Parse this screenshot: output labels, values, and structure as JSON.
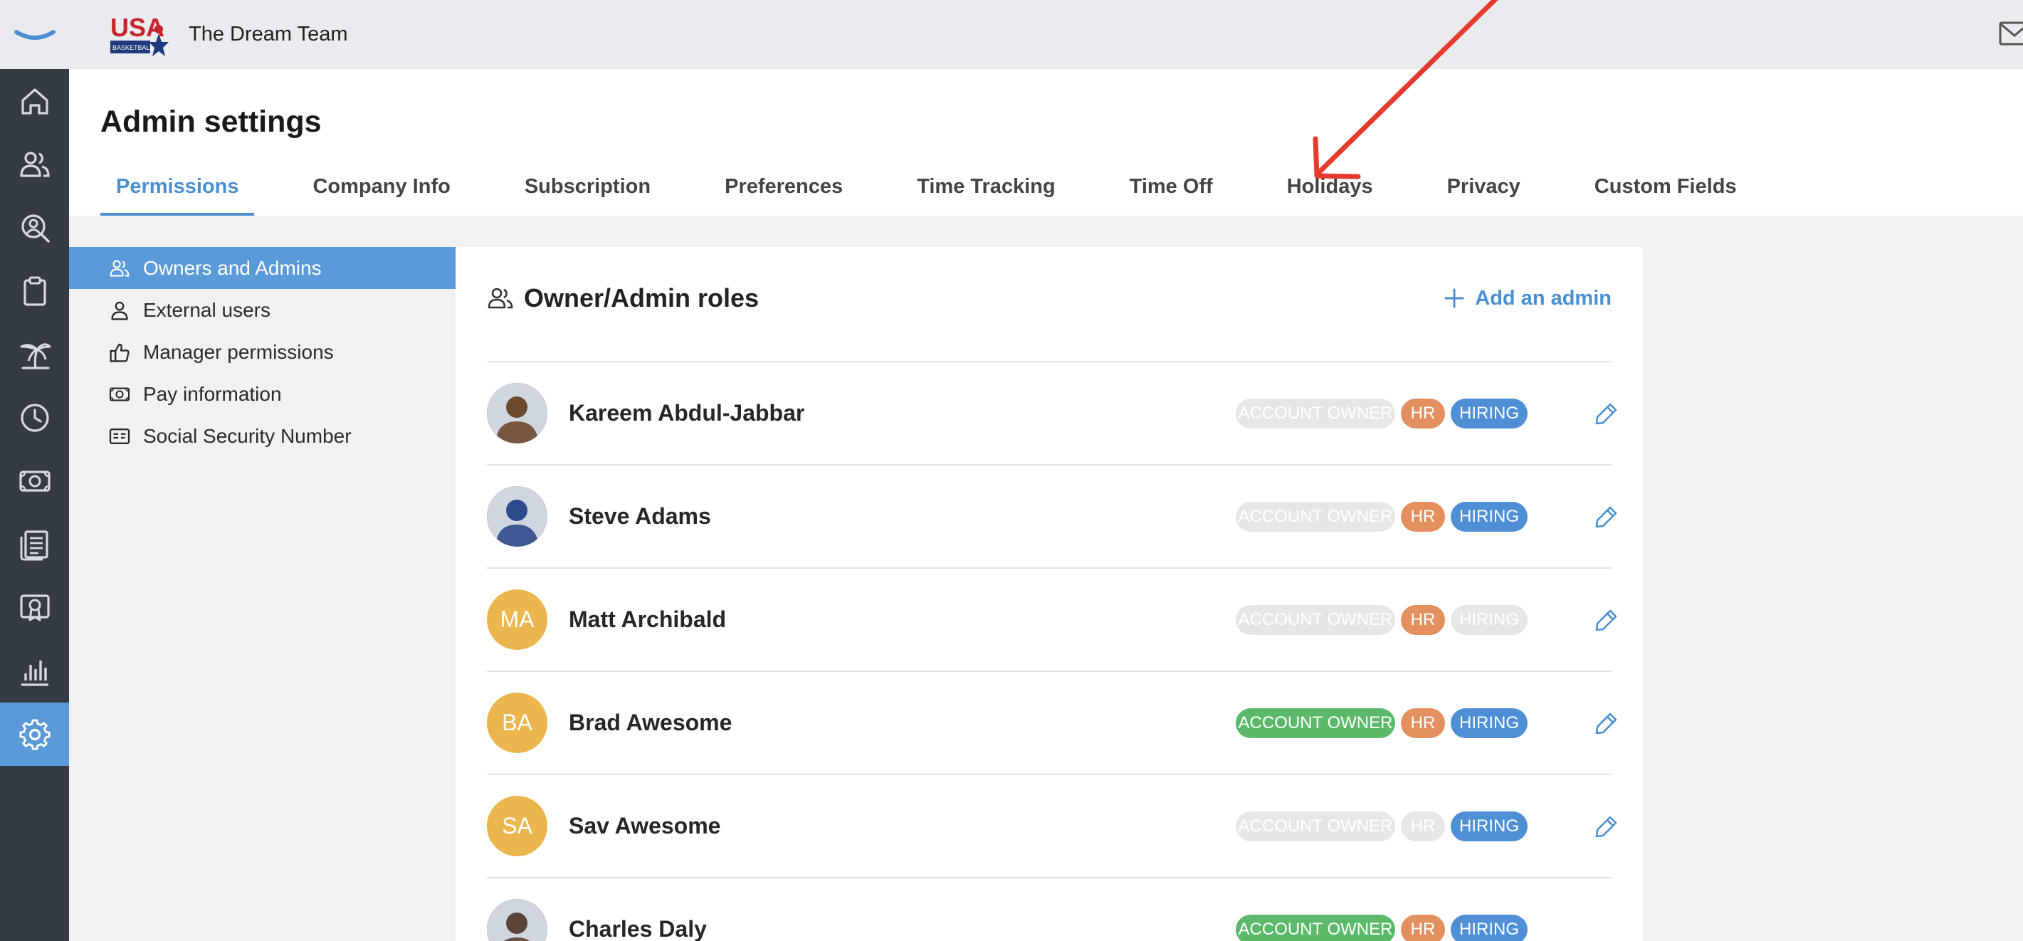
{
  "colors": {
    "rail_bg": "#353b44",
    "accent": "#4a8fd4",
    "active_nav_bg": "#5b9ad9",
    "badge_green": "#5cb96a",
    "badge_orange": "#e48f5e",
    "badge_blue": "#4f8fd6",
    "badge_inactive": "#e5e6e8",
    "avatar_initials_bg": "#ecb64e",
    "annotation_arrow": "#e53b2c"
  },
  "topbar": {
    "company_name": "The Dream Team",
    "logo": {
      "text": "USA",
      "subtext": "BASKETBALL"
    }
  },
  "rail": {
    "items": [
      {
        "icon": "home-icon"
      },
      {
        "icon": "people-icon"
      },
      {
        "icon": "person-search-icon"
      },
      {
        "icon": "clipboard-icon"
      },
      {
        "icon": "palm-tree-icon"
      },
      {
        "icon": "clock-icon"
      },
      {
        "icon": "money-icon"
      },
      {
        "icon": "document-icon"
      },
      {
        "icon": "certificate-icon"
      },
      {
        "icon": "bar-chart-icon"
      },
      {
        "icon": "gear-icon",
        "active": true
      }
    ]
  },
  "header": {
    "title": "Admin settings",
    "tabs": [
      {
        "label": "Permissions",
        "active": true
      },
      {
        "label": "Company Info"
      },
      {
        "label": "Subscription"
      },
      {
        "label": "Preferences"
      },
      {
        "label": "Time Tracking"
      },
      {
        "label": "Time Off"
      },
      {
        "label": "Holidays"
      },
      {
        "label": "Privacy"
      },
      {
        "label": "Custom Fields"
      }
    ]
  },
  "subnav": {
    "items": [
      {
        "label": "Owners and Admins",
        "icon": "people-icon",
        "active": true
      },
      {
        "label": "External users",
        "icon": "person-icon"
      },
      {
        "label": "Manager permissions",
        "icon": "thumbs-up-icon"
      },
      {
        "label": "Pay information",
        "icon": "money-icon"
      },
      {
        "label": "Social Security Number",
        "icon": "id-card-icon"
      }
    ]
  },
  "card": {
    "title": "Owner/Admin roles",
    "add_label": "Add an admin",
    "badge_labels": {
      "owner": "ACCOUNT OWNER",
      "hr": "HR",
      "hiring": "HIRING"
    },
    "rows": [
      {
        "name": "Kareem Abdul-Jabbar",
        "avatar": "photo",
        "owner": false,
        "hr": true,
        "hiring": true
      },
      {
        "name": "Steve Adams",
        "avatar": "photo",
        "owner": false,
        "hr": true,
        "hiring": true
      },
      {
        "name": "Matt Archibald",
        "initials": "MA",
        "avatar": "initials",
        "owner": false,
        "hr": true,
        "hiring": false
      },
      {
        "name": "Brad Awesome",
        "initials": "BA",
        "avatar": "initials",
        "owner": true,
        "hr": true,
        "hiring": true
      },
      {
        "name": "Sav Awesome",
        "initials": "SA",
        "avatar": "initials",
        "owner": false,
        "hr": false,
        "hiring": true
      },
      {
        "name": "Charles Daly",
        "avatar": "photo",
        "owner": true,
        "hr": true,
        "hiring": true
      }
    ]
  }
}
